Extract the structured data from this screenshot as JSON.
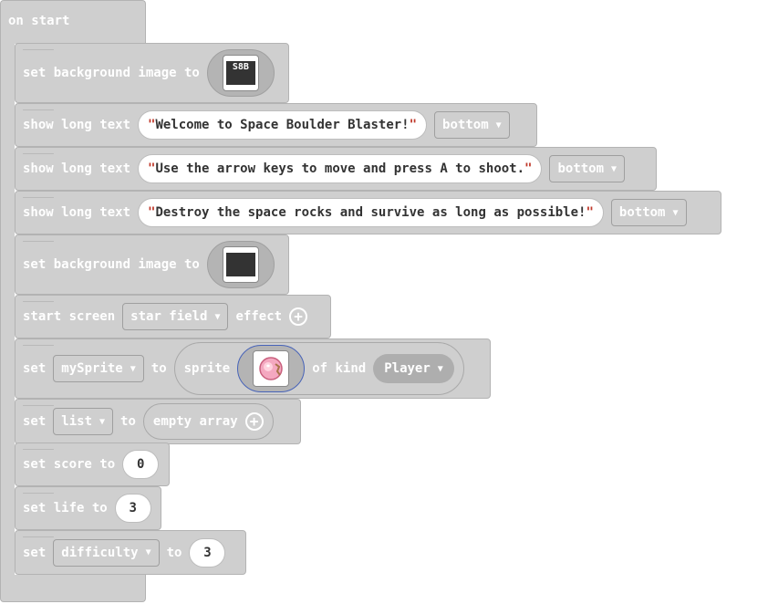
{
  "event": {
    "label": "on start"
  },
  "blocks": {
    "bg1": {
      "set": "set background image to",
      "thumb_text": "S8B"
    },
    "text1": {
      "label": "show long text",
      "value": "Welcome to Space Boulder Blaster!",
      "position": "bottom"
    },
    "text2": {
      "label": "show long text",
      "value": "Use the arrow keys to move and press A to shoot.",
      "position": "bottom"
    },
    "text3": {
      "label": "show long text",
      "value": "Destroy the space rocks and survive as long as possible!",
      "position": "bottom"
    },
    "bg2": {
      "set": "set background image to"
    },
    "effect": {
      "start": "start screen",
      "effect": "star field",
      "suffix": "effect"
    },
    "sprite": {
      "set": "set",
      "var": "mySprite",
      "to": "to",
      "sprite": "sprite",
      "of_kind": "of kind",
      "kind": "Player"
    },
    "list": {
      "set": "set",
      "var": "list",
      "to": "to",
      "empty": "empty array"
    },
    "score": {
      "label": "set score to",
      "value": "0"
    },
    "life": {
      "label": "set life to",
      "value": "3"
    },
    "difficulty": {
      "set": "set",
      "var": "difficulty",
      "to": "to",
      "value": "3"
    }
  },
  "icons": {
    "dropdown": "caret-down-icon",
    "add": "plus-circle-icon",
    "sprite": "pink-sprite-icon"
  },
  "colors": {
    "block": "#cfcfcf",
    "string_quote": "#c0392b",
    "selection": "#4763b8"
  }
}
